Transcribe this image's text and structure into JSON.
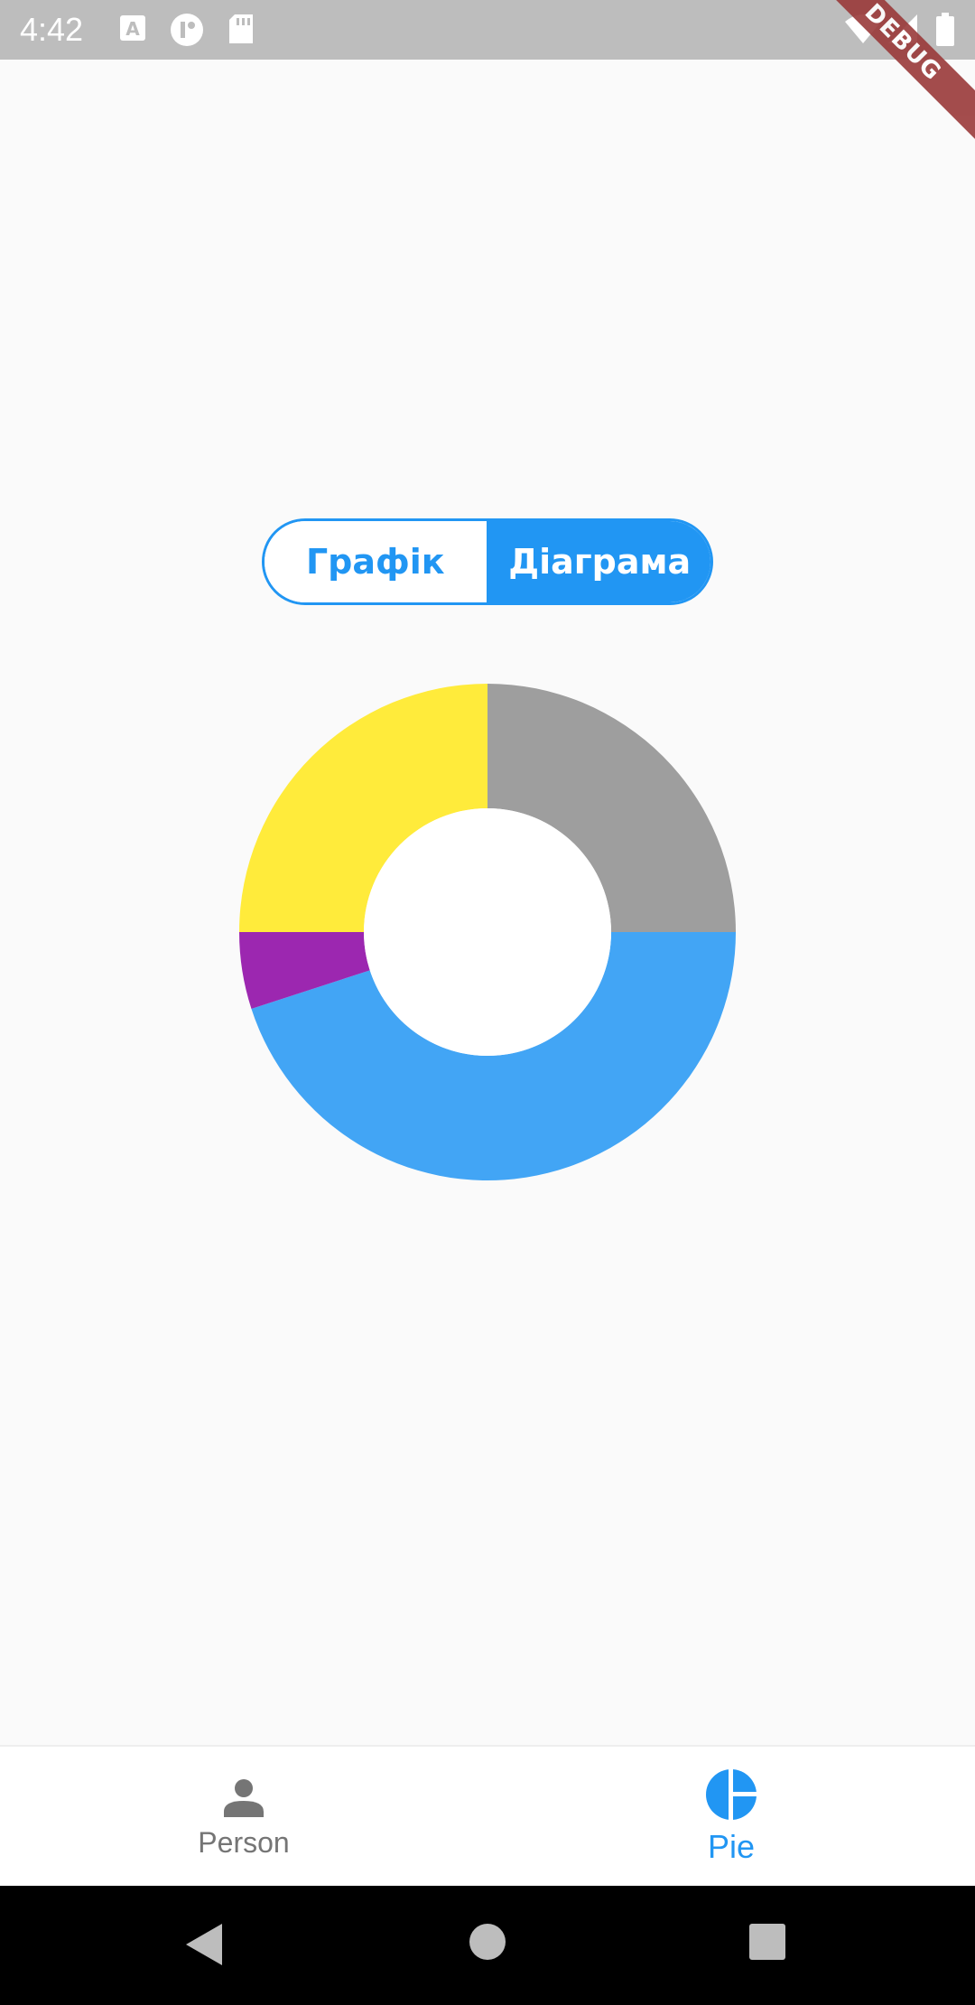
{
  "status_bar": {
    "time": "4:42",
    "left_icons": [
      "a-letter-icon",
      "circle-app-icon",
      "sd-card-icon"
    ],
    "right_icons": [
      "wifi-icon",
      "signal-icon",
      "battery-icon"
    ]
  },
  "debug_banner": "DEBUG",
  "toggle": {
    "options": [
      "Графік",
      "Діаграма"
    ],
    "selected": "Діаграма",
    "accent_color": "#2196f3"
  },
  "chart_data": {
    "type": "pie",
    "donut": true,
    "slices": [
      {
        "value": 25,
        "color": "#9e9e9e"
      },
      {
        "value": 45,
        "color": "#42a5f5"
      },
      {
        "value": 5,
        "color": "#9c27b0"
      },
      {
        "value": 25,
        "color": "#ffeb3b"
      }
    ]
  },
  "bottom_nav": {
    "items": [
      {
        "label": "Person",
        "icon": "person-icon",
        "active": false
      },
      {
        "label": "Pie",
        "icon": "pie-chart-icon",
        "active": true
      }
    ],
    "active_color": "#2196f3",
    "inactive_color": "#757575"
  },
  "system_nav": [
    "back-icon",
    "home-icon",
    "recents-icon"
  ]
}
